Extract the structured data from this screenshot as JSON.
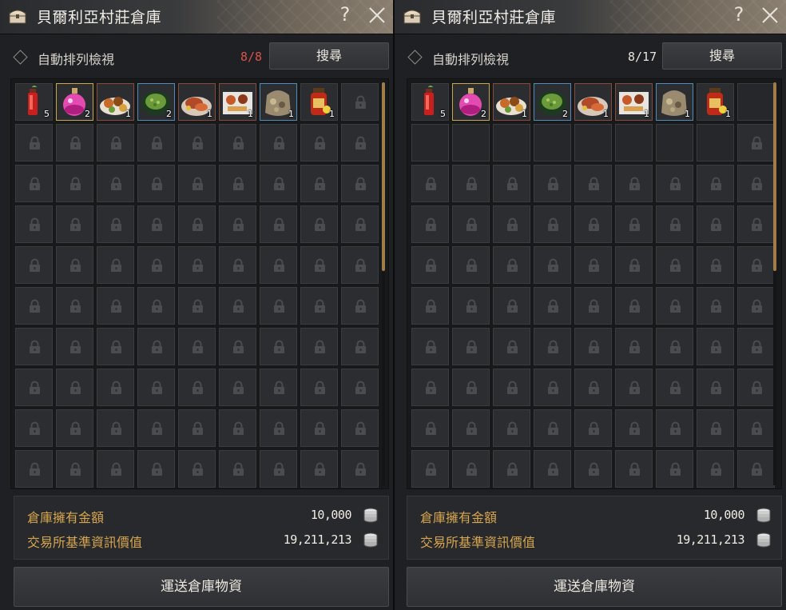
{
  "left": {
    "title": "貝爾利亞村莊倉庫",
    "help": "?",
    "sort_label": "自動排列檢視",
    "count": "8/8",
    "count_color": "#d9534a",
    "search_label": "搜尋",
    "money_label": "倉庫擁有金額",
    "money_value": "10,000",
    "market_label": "交易所基準資訊價值",
    "market_value": "19,211,213",
    "ship_label": "運送倉庫物資",
    "items": [
      {
        "icon": "red-potion-icon",
        "qty": "5",
        "grade": "none"
      },
      {
        "icon": "pink-elixir-icon",
        "qty": "2",
        "grade": "gold"
      },
      {
        "icon": "meal-platter-icon",
        "qty": "1",
        "grade": "red"
      },
      {
        "icon": "green-dish-icon",
        "qty": "2",
        "grade": "blue"
      },
      {
        "icon": "meat-dish-icon",
        "qty": "1",
        "grade": "red"
      },
      {
        "icon": "banquet-plate-icon",
        "qty": "1",
        "grade": "red"
      },
      {
        "icon": "grain-sack-icon",
        "qty": "1",
        "grade": "blue"
      },
      {
        "icon": "honey-jar-icon",
        "qty": "1",
        "grade": "none"
      }
    ],
    "empty_unlocked": 0
  },
  "right": {
    "title": "貝爾利亞村莊倉庫",
    "help": "?",
    "sort_label": "自動排列檢視",
    "count": "8/17",
    "count_color": "#e8e4dc",
    "search_label": "搜尋",
    "money_label": "倉庫擁有金額",
    "money_value": "10,000",
    "market_label": "交易所基準資訊價值",
    "market_value": "19,211,213",
    "ship_label": "運送倉庫物資",
    "items": [
      {
        "icon": "red-potion-icon",
        "qty": "5",
        "grade": "none"
      },
      {
        "icon": "pink-elixir-icon",
        "qty": "2",
        "grade": "gold"
      },
      {
        "icon": "meal-platter-icon",
        "qty": "1",
        "grade": "red"
      },
      {
        "icon": "green-dish-icon",
        "qty": "2",
        "grade": "blue"
      },
      {
        "icon": "meat-dish-icon",
        "qty": "1",
        "grade": "red"
      },
      {
        "icon": "banquet-plate-icon",
        "qty": "1",
        "grade": "red"
      },
      {
        "icon": "grain-sack-icon",
        "qty": "1",
        "grade": "blue"
      },
      {
        "icon": "honey-jar-icon",
        "qty": "1",
        "grade": "none"
      }
    ],
    "empty_unlocked": 9
  }
}
